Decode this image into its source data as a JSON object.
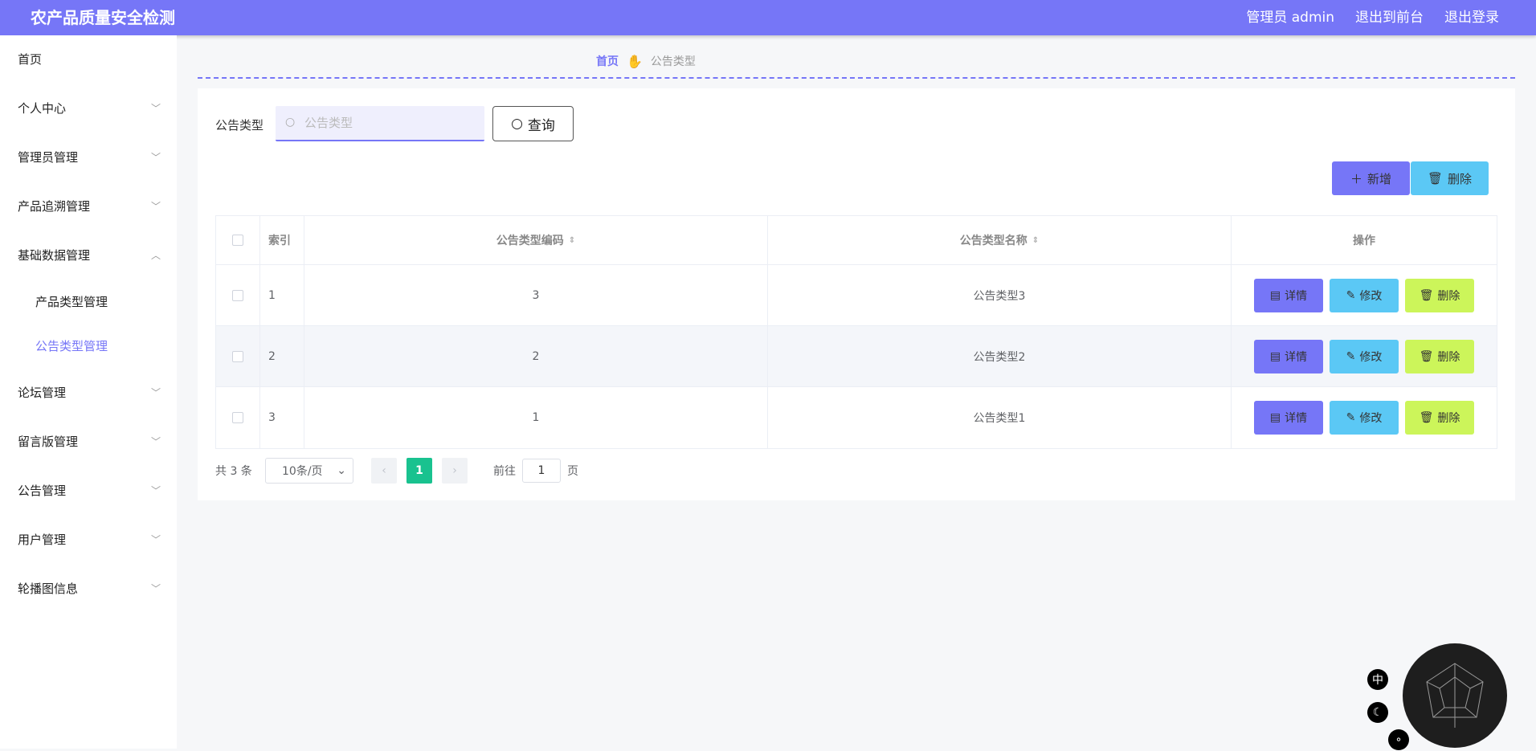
{
  "header": {
    "title": "农产品质量安全检测",
    "admin_label": "管理员 admin",
    "to_front_label": "退出到前台",
    "logout_label": "退出登录"
  },
  "sidebar": {
    "items": [
      {
        "label": "首页",
        "chevron": ""
      },
      {
        "label": "个人中心",
        "chevron": "﹀"
      },
      {
        "label": "管理员管理",
        "chevron": "﹀"
      },
      {
        "label": "产品追溯管理",
        "chevron": "﹀"
      },
      {
        "label": "基础数据管理",
        "chevron": "︿"
      },
      {
        "label": "产品类型管理",
        "chevron": ""
      },
      {
        "label": "公告类型管理",
        "chevron": ""
      },
      {
        "label": "论坛管理",
        "chevron": "﹀"
      },
      {
        "label": "留言版管理",
        "chevron": "﹀"
      },
      {
        "label": "公告管理",
        "chevron": "﹀"
      },
      {
        "label": "用户管理",
        "chevron": "﹀"
      },
      {
        "label": "轮播图信息",
        "chevron": "﹀"
      }
    ]
  },
  "breadcrumb": {
    "home": "首页",
    "current": "公告类型"
  },
  "search": {
    "label": "公告类型",
    "placeholder": "公告类型",
    "value": "",
    "query_label": "查询"
  },
  "toolbar": {
    "add_label": "新增",
    "delete_label": "删除"
  },
  "table": {
    "headers": {
      "index": "索引",
      "code": "公告类型编码",
      "name": "公告类型名称",
      "ops": "操作"
    },
    "rows": [
      {
        "index": "1",
        "code": "3",
        "name": "公告类型3"
      },
      {
        "index": "2",
        "code": "2",
        "name": "公告类型2"
      },
      {
        "index": "3",
        "code": "1",
        "name": "公告类型1"
      }
    ],
    "op_labels": {
      "detail": "详情",
      "edit": "修改",
      "delete": "删除"
    }
  },
  "pagination": {
    "total": "共 3 条",
    "page_size": "10条/页",
    "current_page": "1",
    "goto_prefix": "前往",
    "goto_value": "1",
    "goto_suffix": "页"
  },
  "tools": {
    "lang": "中"
  },
  "colors": {
    "accent": "#7676f7",
    "cyan": "#5bc8f5",
    "lime": "#ccf55a",
    "page_active": "#19c28f"
  }
}
